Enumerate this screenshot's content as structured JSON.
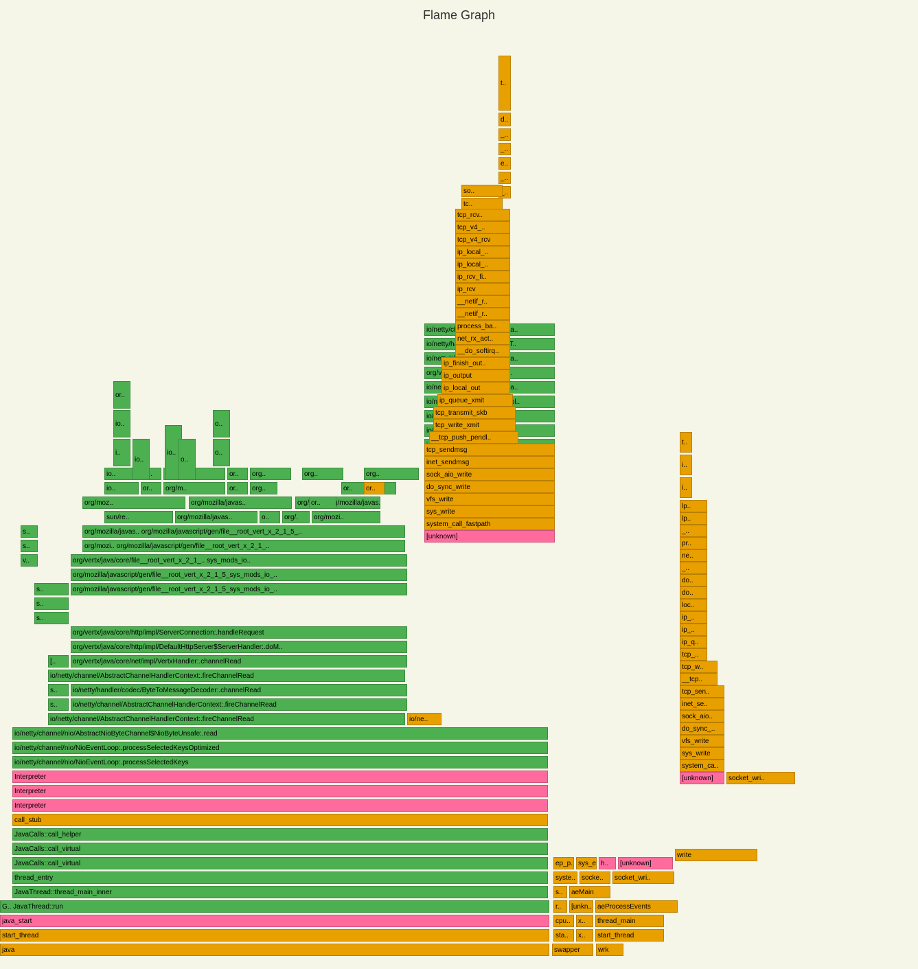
{
  "title": "Flame Graph",
  "frames": []
}
